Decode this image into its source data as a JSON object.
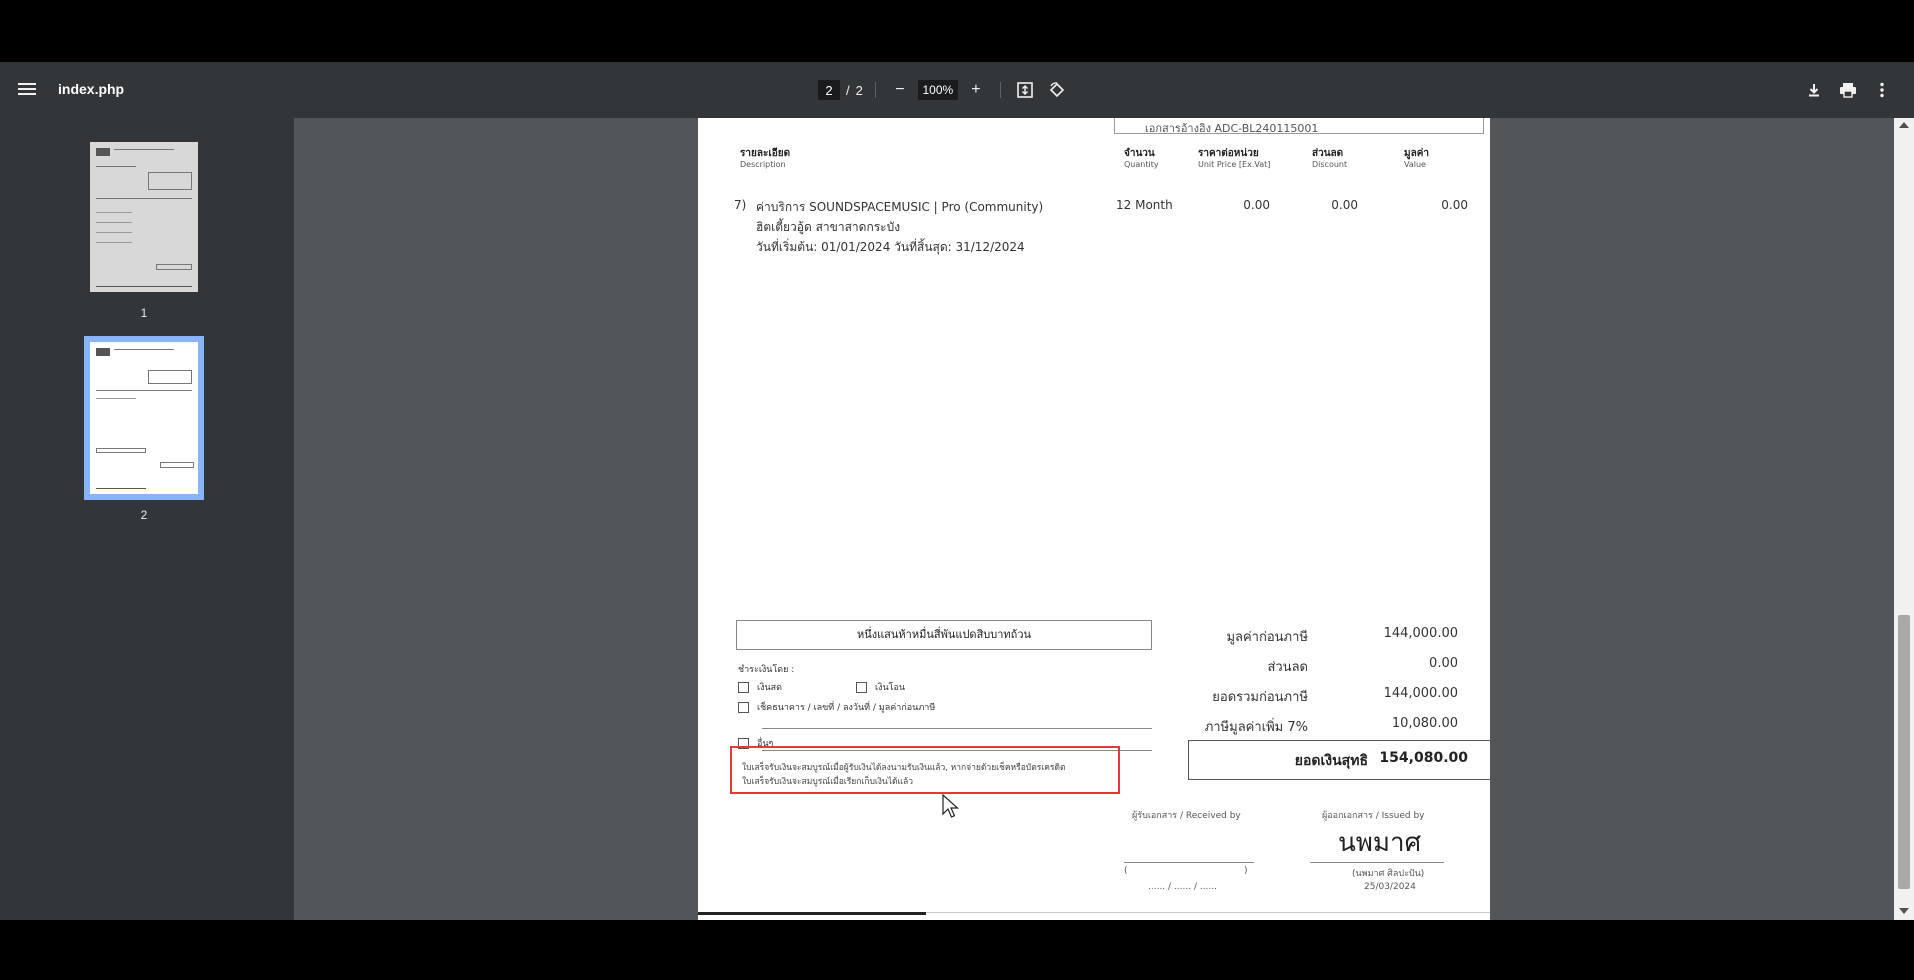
{
  "toolbar": {
    "title": "index.php",
    "page_current": "2",
    "page_separator": "/",
    "page_total": "2",
    "zoom": "100%",
    "zoom_out": "−",
    "zoom_in": "+"
  },
  "thumbnails": [
    {
      "label": "1",
      "selected": false
    },
    {
      "label": "2",
      "selected": true
    }
  ],
  "document": {
    "doc_ref": "เอกสารอ้างอิง   ADC-BL240115001",
    "columns": [
      {
        "th": "รายละเอียด",
        "en": "Description"
      },
      {
        "th": "จำนวน",
        "en": "Quantity"
      },
      {
        "th": "ราคาต่อหน่วย",
        "en": "Unit Price [Ex.Vat]"
      },
      {
        "th": "ส่วนลด",
        "en": "Discount"
      },
      {
        "th": "มูลค่า",
        "en": "Value"
      }
    ],
    "item": {
      "no": "7)",
      "line1": "ค่าบริการ SOUNDSPACEMUSIC | Pro (Community)",
      "line2": "ฮิตเตี้ยวอู้ด สาขาสาดกระบัง",
      "line3": "วันที่เริ่มต้น: 01/01/2024   วันที่สิ้นสุด: 31/12/2024",
      "quantity": "12 Month",
      "unit_price": "0.00",
      "discount": "0.00",
      "value": "0.00"
    },
    "amount_words": "หนึ่งแสนห้าหมื่นสี่พันแปดสิบบาทถ้วน",
    "payment": {
      "label": "ชำระเงินโดย :",
      "cash": "เงินสด",
      "transfer": "เงินโอน",
      "cheque": "เช็คธนาคาร / เลขที่ / ลงวันที่ / มูลค่าก่อนภาษี",
      "other": "อื่นๆ"
    },
    "note_line1": "ใบเสร็จรับเงินจะสมบูรณ์เมื่อผู้รับเงินได้ลงนามรับเงินแล้ว, หากจ่ายด้วยเช็คหรือบัตรเครดิต",
    "note_line2": "ใบเสร็จรับเงินจะสมบูรณ์เมื่อเรียกเก็บเงินได้แล้ว",
    "summary": [
      {
        "label": "มูลค่าก่อนภาษี",
        "value": "144,000.00"
      },
      {
        "label": "ส่วนลด",
        "value": "0.00"
      },
      {
        "label": "ยอดรวมก่อนภาษี",
        "value": "144,000.00"
      },
      {
        "label": "ภาษีมูลค่าเพิ่ม 7%",
        "value": "10,080.00"
      }
    ],
    "net": {
      "label": "ยอดเงินสุทธิ",
      "value": "154,080.00"
    },
    "received_by": "ผู้รับเอกสาร / Received by",
    "issued_by": "ผู้ออกเอกสาร / Issued by",
    "signature": "นพมาศ",
    "receiver_paren_open": "(",
    "receiver_paren_close": ")",
    "receiver_date": "...... / ...... / ......",
    "issuer_name": "(นพมาศ  ศิลปะปัน)",
    "issue_date": "25/03/2024"
  }
}
